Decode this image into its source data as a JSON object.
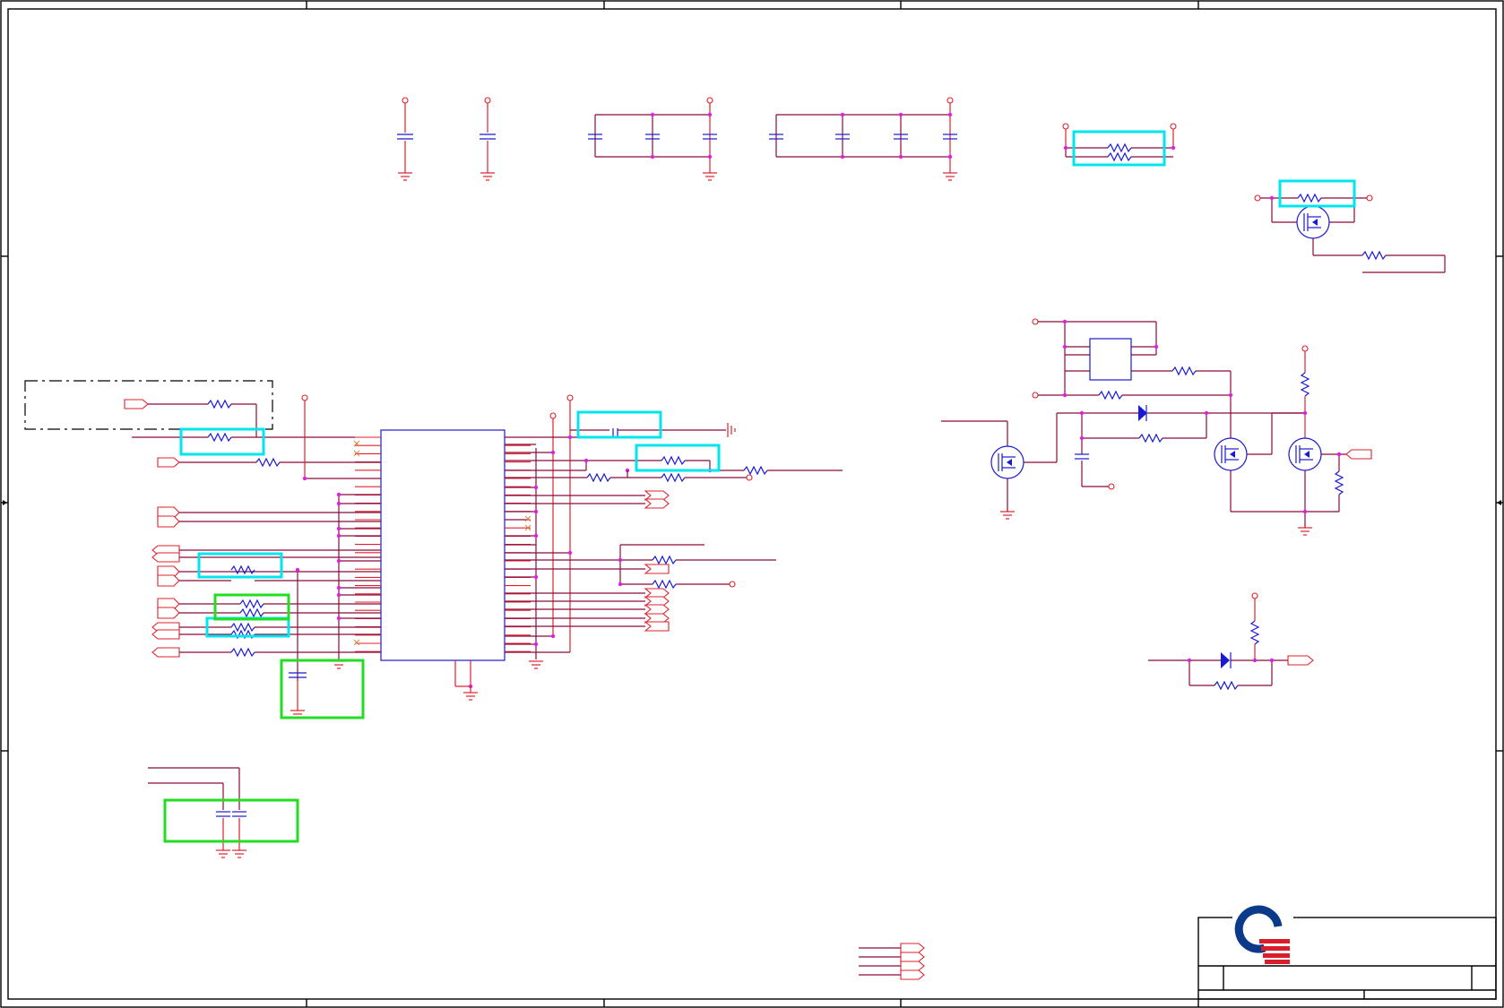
{
  "canvas": {
    "background": "#ffffff"
  },
  "colors": {
    "wire": "#8b0a3c",
    "pin": "#e0202a",
    "component": "#1a1ad0",
    "junction": "#e020e0",
    "highlight_cyan": "#00e5ee",
    "highlight_green": "#22dd22",
    "frame": "#000000",
    "logo_blue": "#0b3a8a",
    "logo_red": "#d81e2a"
  },
  "title_block": {
    "logo": "company-logo"
  },
  "highlights": {
    "cyan_count": 7,
    "green_count": 3
  }
}
